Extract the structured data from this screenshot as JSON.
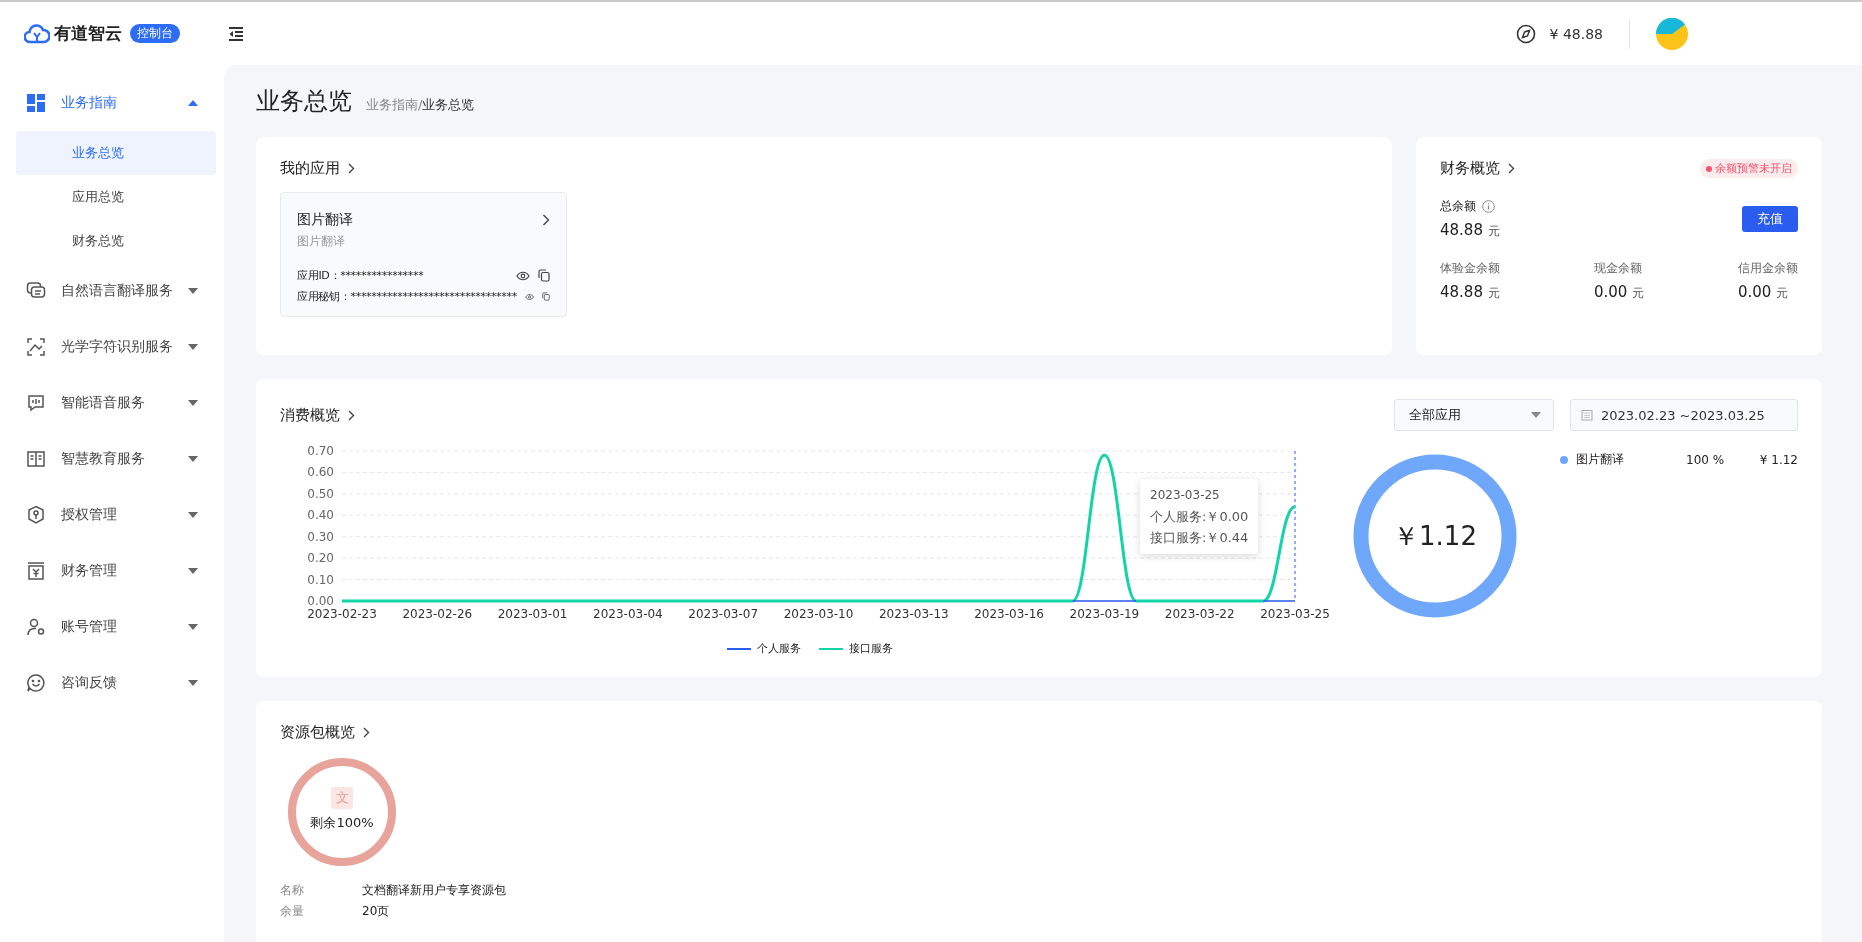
{
  "header": {
    "brand": "有道智云",
    "badge": "控制台",
    "balance": "¥ 48.88"
  },
  "sidebar": {
    "items": [
      {
        "label": "业务指南",
        "expanded": true,
        "children": [
          {
            "label": "业务总览",
            "selected": true
          },
          {
            "label": "应用总览",
            "selected": false
          },
          {
            "label": "财务总览",
            "selected": false
          }
        ]
      },
      {
        "label": "自然语言翻译服务",
        "expanded": false
      },
      {
        "label": "光学字符识别服务",
        "expanded": false
      },
      {
        "label": "智能语音服务",
        "expanded": false
      },
      {
        "label": "智慧教育服务",
        "expanded": false
      },
      {
        "label": "授权管理",
        "expanded": false
      },
      {
        "label": "财务管理",
        "expanded": false
      },
      {
        "label": "账号管理",
        "expanded": false
      },
      {
        "label": "咨询反馈",
        "expanded": false
      }
    ]
  },
  "page": {
    "title": "业务总览",
    "breadcrumb": [
      "业务指南",
      "业务总览"
    ],
    "breadcrumb_separator": "/"
  },
  "my_apps": {
    "title": "我的应用",
    "apps": [
      {
        "name": "图片翻译",
        "subtitle": "图片翻译",
        "fields": [
          {
            "label": "应用ID：",
            "value": "****************"
          },
          {
            "label": "应用秘钥：",
            "value": "********************************"
          }
        ]
      }
    ]
  },
  "finance": {
    "title": "财务概览",
    "tag": "余额预警未开启",
    "total_label": "总余额",
    "total": "48.88",
    "unit": "元",
    "button": "充值",
    "balances": [
      {
        "label": "体验金余额",
        "value": "48.88",
        "unit": "元"
      },
      {
        "label": "现金余额",
        "value": "0.00",
        "unit": "元"
      },
      {
        "label": "信用金余额",
        "value": "0.00",
        "unit": "元"
      }
    ]
  },
  "consumption": {
    "title": "消费概览",
    "app_select": "全部应用",
    "date_range": "2023.02.23 ~2023.03.25",
    "chart_data": {
      "type": "line",
      "categories": [
        "2023-02-23",
        null,
        null,
        "2023-02-26",
        null,
        null,
        "2023-03-01",
        null,
        null,
        "2023-03-04",
        null,
        null,
        "2023-03-07",
        null,
        null,
        "2023-03-10",
        null,
        null,
        "2023-03-13",
        null,
        null,
        "2023-03-16",
        null,
        null,
        "2023-03-19",
        null,
        null,
        "2023-03-22",
        null,
        null,
        "2023-03-25"
      ],
      "series": [
        {
          "name": "个人服务",
          "color": "#2b5cf0",
          "values": [
            null,
            null,
            null,
            null,
            null,
            null,
            null,
            null,
            null,
            null,
            null,
            null,
            null,
            null,
            null,
            null,
            null,
            null,
            null,
            null,
            null,
            null,
            null,
            0,
            0,
            0,
            null,
            null,
            null,
            0,
            0
          ]
        },
        {
          "name": "接口服务",
          "color": "#12d4a6",
          "values": [
            0,
            0,
            0,
            0,
            0,
            0,
            0,
            0,
            0,
            0,
            0,
            0,
            0,
            0,
            0,
            0,
            0,
            0,
            0,
            0,
            0,
            0,
            0,
            0,
            0.68,
            0,
            0,
            0,
            0,
            0,
            0.44
          ]
        }
      ],
      "ylim": [
        0,
        0.7
      ],
      "yticks": [
        {
          "value": 0,
          "label": "0.00"
        },
        {
          "value": 0.1,
          "label": "0.10"
        },
        {
          "value": 0.2,
          "label": "0.20"
        },
        {
          "value": 0.3,
          "label": "0.30"
        },
        {
          "value": 0.4,
          "label": "0.40"
        },
        {
          "value": 0.5,
          "label": "0.50"
        },
        {
          "value": 0.6,
          "label": "0.60"
        },
        {
          "value": 0.7,
          "label": "0.70"
        }
      ],
      "grid": true,
      "legend": "bottom"
    },
    "tooltip": {
      "title": "2023-03-25",
      "lines": [
        "个人服务:￥0.00",
        "接口服务:￥0.44"
      ]
    },
    "share": {
      "center": "￥1.12",
      "legend_rows": [
        {
          "name": "图片翻译",
          "color": "#6fa8fb",
          "percent": "100 %",
          "amount": "¥ 1.12"
        }
      ]
    }
  },
  "resource_packs": {
    "title": "资源包概览",
    "packs": [
      {
        "icon_char": "文",
        "remaining": "剩余100%",
        "level": 1,
        "fields": [
          {
            "label": "名称",
            "value": "文档翻译新用户专享资源包"
          },
          {
            "label": "余量",
            "value": "20页"
          }
        ]
      }
    ]
  }
}
